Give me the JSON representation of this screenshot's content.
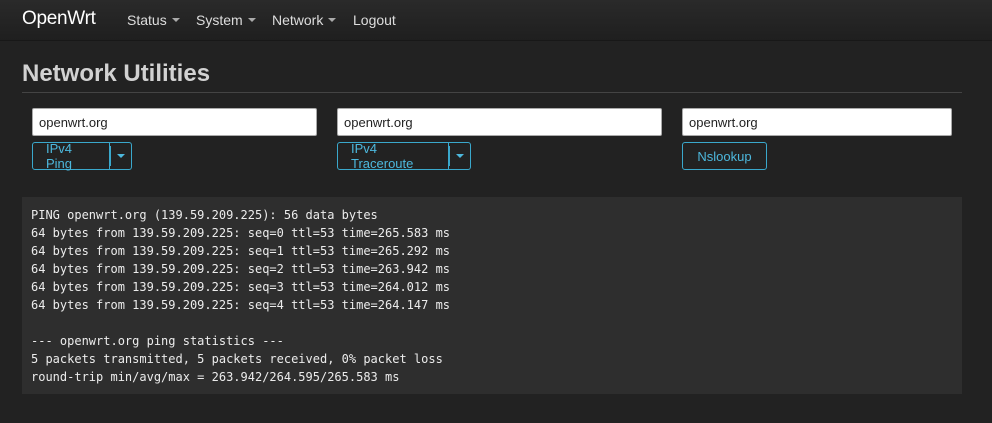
{
  "brand": "OpenWrt",
  "nav": {
    "status": "Status",
    "system": "System",
    "network": "Network",
    "logout": "Logout"
  },
  "page": {
    "title": "Network Utilities"
  },
  "ping": {
    "host": "openwrt.org",
    "button_label": "IPv4 Ping"
  },
  "traceroute": {
    "host": "openwrt.org",
    "button_label": "IPv4 Traceroute"
  },
  "nslookup": {
    "host": "openwrt.org",
    "button_label": "Nslookup"
  },
  "colors": {
    "background": "#222222",
    "accent": "#4db8dd",
    "output_bg": "#2e2e2e"
  },
  "output": {
    "lines": [
      "PING openwrt.org (139.59.209.225): 56 data bytes",
      "64 bytes from 139.59.209.225: seq=0 ttl=53 time=265.583 ms",
      "64 bytes from 139.59.209.225: seq=1 ttl=53 time=265.292 ms",
      "64 bytes from 139.59.209.225: seq=2 ttl=53 time=263.942 ms",
      "64 bytes from 139.59.209.225: seq=3 ttl=53 time=264.012 ms",
      "64 bytes from 139.59.209.225: seq=4 ttl=53 time=264.147 ms",
      "",
      "--- openwrt.org ping statistics ---",
      "5 packets transmitted, 5 packets received, 0% packet loss",
      "round-trip min/avg/max = 263.942/264.595/265.583 ms"
    ]
  }
}
